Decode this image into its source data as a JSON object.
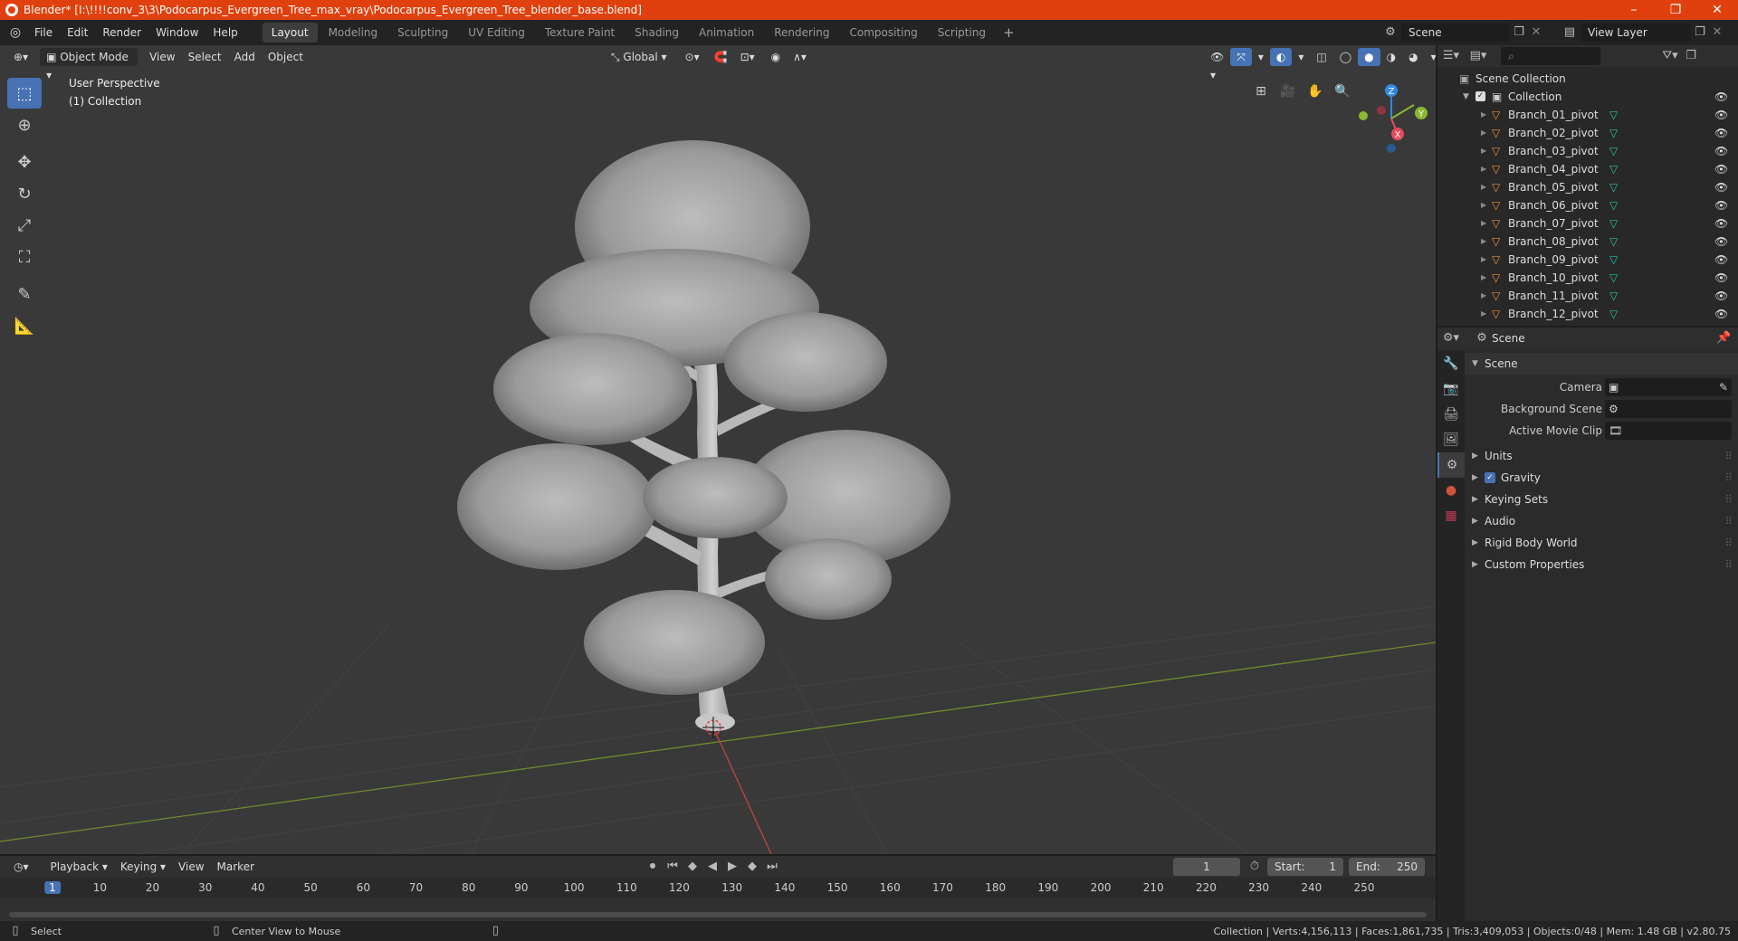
{
  "window": {
    "title": "Blender* [I:\\!!!!conv_3\\3\\Podocarpus_Evergreen_Tree_max_vray\\Podocarpus_Evergreen_Tree_blender_base.blend]",
    "controls": [
      "–",
      "❐",
      "✕"
    ]
  },
  "menu": {
    "items": [
      "File",
      "Edit",
      "Render",
      "Window",
      "Help"
    ],
    "workspaces": [
      "Layout",
      "Modeling",
      "Sculpting",
      "UV Editing",
      "Texture Paint",
      "Shading",
      "Animation",
      "Rendering",
      "Compositing",
      "Scripting"
    ],
    "active_workspace": "Layout",
    "add_tab": "+",
    "scene_name": "Scene",
    "view_layer": "View Layer"
  },
  "viewport": {
    "mode": "Object Mode",
    "menus": [
      "View",
      "Select",
      "Add",
      "Object"
    ],
    "orientation": "Global",
    "perspective_label": "User Perspective",
    "collection_label": "(1) Collection",
    "gizmo_axes": [
      "Z",
      "Y",
      "X"
    ],
    "axis_colors": {
      "x": "#e44b5d",
      "y": "#8ab831",
      "z": "#2f8ae4"
    }
  },
  "outliner": {
    "root": "Scene Collection",
    "collection": "Collection",
    "items": [
      "Branch_01_pivot",
      "Branch_02_pivot",
      "Branch_03_pivot",
      "Branch_04_pivot",
      "Branch_05_pivot",
      "Branch_06_pivot",
      "Branch_07_pivot",
      "Branch_08_pivot",
      "Branch_09_pivot",
      "Branch_10_pivot",
      "Branch_11_pivot",
      "Branch_12_pivot"
    ]
  },
  "properties": {
    "header": "Scene",
    "panel_title": "Scene",
    "fields": [
      {
        "label": "Camera"
      },
      {
        "label": "Background Scene"
      },
      {
        "label": "Active Movie Clip"
      }
    ],
    "sections": [
      "Units",
      "Gravity",
      "Keying Sets",
      "Audio",
      "Rigid Body World",
      "Custom Properties"
    ],
    "gravity_checked": true
  },
  "timeline": {
    "menus": [
      "Playback",
      "Keying",
      "View",
      "Marker"
    ],
    "current_frame": "1",
    "start_label": "Start:",
    "start": "1",
    "end_label": "End:",
    "end": "250",
    "ruler": [
      "1",
      "10",
      "20",
      "30",
      "40",
      "50",
      "60",
      "70",
      "80",
      "90",
      "100",
      "110",
      "120",
      "130",
      "140",
      "150",
      "160",
      "170",
      "180",
      "190",
      "200",
      "210",
      "220",
      "230",
      "240",
      "250"
    ]
  },
  "status": {
    "left_action": "Select",
    "mid_action": "Center View to Mouse",
    "stats": "Collection | Verts:4,156,113 | Faces:1,861,735 | Tris:3,409,053 | Objects:0/48 | Mem: 1.48 GB | v2.80.75"
  }
}
